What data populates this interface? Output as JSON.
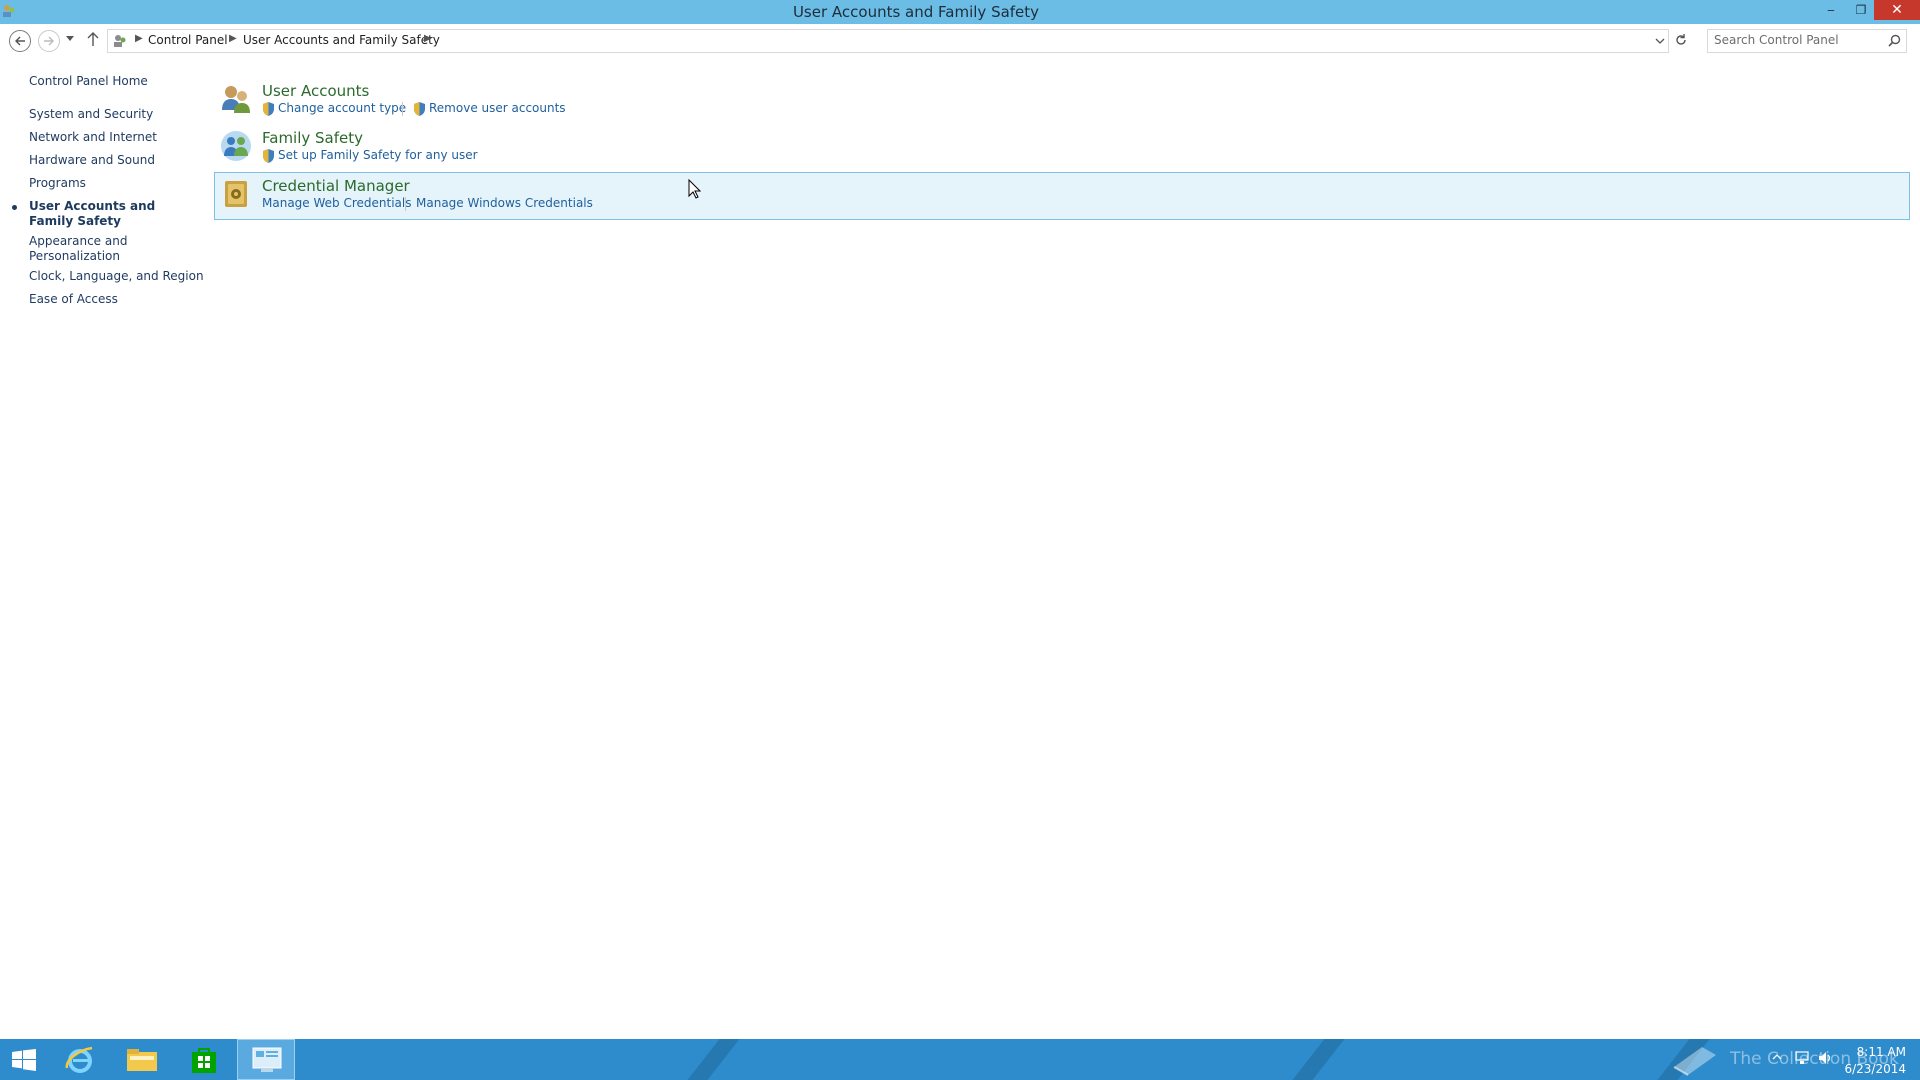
{
  "window": {
    "title": "User Accounts and Family Safety"
  },
  "titlebar_buttons": {
    "minimize": "‒",
    "restore": "❐",
    "close": "✕"
  },
  "address_bar": {
    "breadcrumbs": [
      "Control Panel",
      "User Accounts and Family Safety"
    ],
    "search_placeholder": "Search Control Panel"
  },
  "left_nav": {
    "home": "Control Panel Home",
    "items": [
      {
        "label": "System and Security",
        "current": false
      },
      {
        "label": "Network and Internet",
        "current": false
      },
      {
        "label": "Hardware and Sound",
        "current": false
      },
      {
        "label": "Programs",
        "current": false
      },
      {
        "label": "User Accounts and Family Safety",
        "current": true
      },
      {
        "label": "Appearance and Personalization",
        "current": false
      },
      {
        "label": "Clock, Language, and Region",
        "current": false
      },
      {
        "label": "Ease of Access",
        "current": false
      }
    ]
  },
  "categories": [
    {
      "title": "User Accounts",
      "icon": "users-icon",
      "tasks": [
        {
          "label": "Change account type",
          "shield": true
        },
        {
          "label": "Remove user accounts",
          "shield": true
        }
      ]
    },
    {
      "title": "Family Safety",
      "icon": "family-safety-icon",
      "tasks": [
        {
          "label": "Set up Family Safety for any user",
          "shield": true
        }
      ]
    },
    {
      "title": "Credential Manager",
      "icon": "credential-vault-icon",
      "highlighted": true,
      "tasks": [
        {
          "label": "Manage Web Credentials",
          "shield": false
        },
        {
          "label": "Manage Windows Credentials",
          "shield": false
        }
      ]
    }
  ],
  "taskbar": {
    "apps": [
      "start-icon",
      "internet-explorer-icon",
      "file-explorer-icon",
      "store-icon",
      "control-panel-icon"
    ],
    "watermark": "The Collection Book",
    "time": "8:11 AM",
    "date": "6/23/2014"
  },
  "colors": {
    "titlebar": "#6bbde6",
    "taskbar": "#2e8ccc",
    "category_title": "#2c6a2c",
    "link": "#1f5f9c",
    "highlight_bg": "#e5f3fb",
    "highlight_border": "#7fc0e6"
  }
}
